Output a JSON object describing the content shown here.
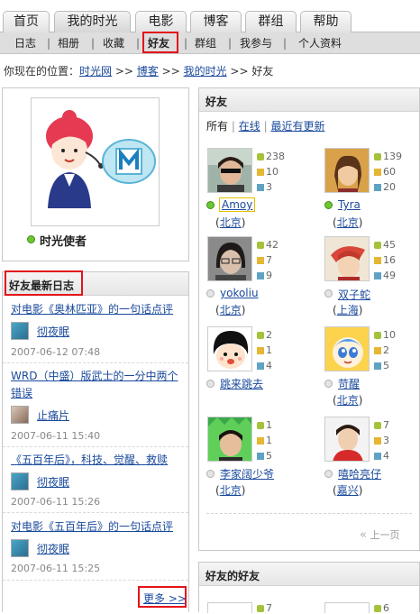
{
  "nav": {
    "tabs": [
      "首页",
      "我的时光",
      "电影",
      "博客",
      "群组",
      "帮助"
    ],
    "sub_items": [
      "日志",
      "相册",
      "收藏",
      "好友",
      "群组",
      "我参与",
      "个人资料"
    ],
    "active_sub": "好友"
  },
  "breadcrumb": {
    "prefix": "你现在的位置：",
    "items": [
      "时光网",
      "博客",
      "我的时光",
      "好友"
    ],
    "separator": ">>"
  },
  "profile": {
    "name": "时光使者",
    "online": true
  },
  "blog": {
    "title": "好友最新日志",
    "entries": [
      {
        "title": "对电影《奥林匹亚》的一句话点评",
        "author": "彻夜眠",
        "date": "2007-06-12 07:48"
      },
      {
        "title": "WRD（中盛）版武士的一分中两个错误",
        "author": "止痛片",
        "date": "2007-06-11 15:40"
      },
      {
        "title": "《五百年后》，科技、觉醒、救赎",
        "author": "彻夜眠",
        "date": "2007-06-11 15:26"
      },
      {
        "title": "对电影《五百年后》的一句话点评",
        "author": "彻夜眠",
        "date": "2007-06-11 15:25"
      }
    ],
    "more": "更多 >>"
  },
  "friends": {
    "title": "好友",
    "filters": [
      "所有",
      "在线",
      "最近有更新"
    ],
    "filter_sep": "|",
    "list": [
      {
        "name": "Amoy",
        "city": "北京",
        "online": true,
        "stats": [
          238,
          10,
          3
        ]
      },
      {
        "name": "Tyra",
        "city": "北京",
        "online": true,
        "stats": [
          139,
          60,
          20
        ]
      },
      {
        "name": "yokoliu",
        "city": "北京",
        "online": false,
        "stats": [
          42,
          7,
          9
        ]
      },
      {
        "name": "双子蛇",
        "city": "上海",
        "online": false,
        "stats": [
          45,
          16,
          49
        ]
      },
      {
        "name": "跳来跳去",
        "city": "",
        "online": false,
        "stats": [
          2,
          1,
          4
        ]
      },
      {
        "name": "苛醒",
        "city": "北京",
        "online": false,
        "stats": [
          10,
          2,
          5
        ]
      },
      {
        "name": "李家阔少爷",
        "city": "北京",
        "online": false,
        "stats": [
          1,
          1,
          5
        ]
      },
      {
        "name": "嘻哈亮仔",
        "city": "嘉兴",
        "online": false,
        "stats": [
          7,
          3,
          4
        ]
      }
    ],
    "prev_page": "上一页",
    "prev_icon": "double-chevron-left-icon"
  },
  "friends_of_friends": {
    "title": "好友的好友",
    "partial_stats": [
      7,
      6
    ]
  },
  "colors": {
    "link": "#1a4a9c",
    "highlight_red": "#e3141a",
    "online_green": "#6cc631"
  }
}
